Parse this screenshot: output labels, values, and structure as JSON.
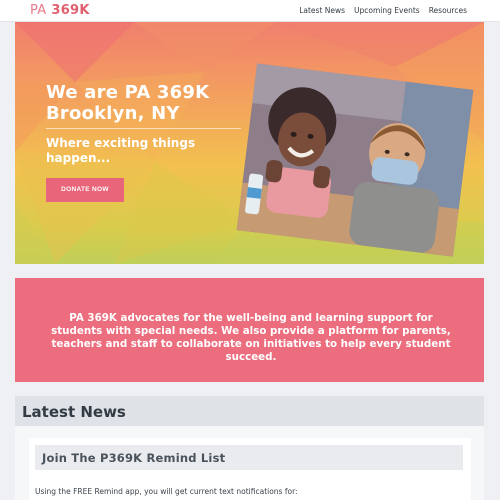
{
  "brand": {
    "prefix": "PA",
    "number": "369K"
  },
  "nav": {
    "items": [
      {
        "label": "Latest News"
      },
      {
        "label": "Upcoming Events"
      },
      {
        "label": "Resources"
      }
    ]
  },
  "hero": {
    "title": "We are PA 369K Brooklyn, NY",
    "subtitle": "Where exciting things happen...",
    "donate_label": "DONATE NOW"
  },
  "mission": {
    "text": "PA 369K advocates for the well-being and learning support for students with special needs. We also provide a platform for parents, teachers and staff to collaborate on initiatives to help every student succeed."
  },
  "news": {
    "title": "Latest News",
    "card_title": "Join The P369K Remind List",
    "card_text": "Using the FREE Remind app, you will get current text notifications for:"
  },
  "colors": {
    "accent": "#ec6d7d",
    "button": "#e8657a",
    "brand": "#e0606e"
  }
}
